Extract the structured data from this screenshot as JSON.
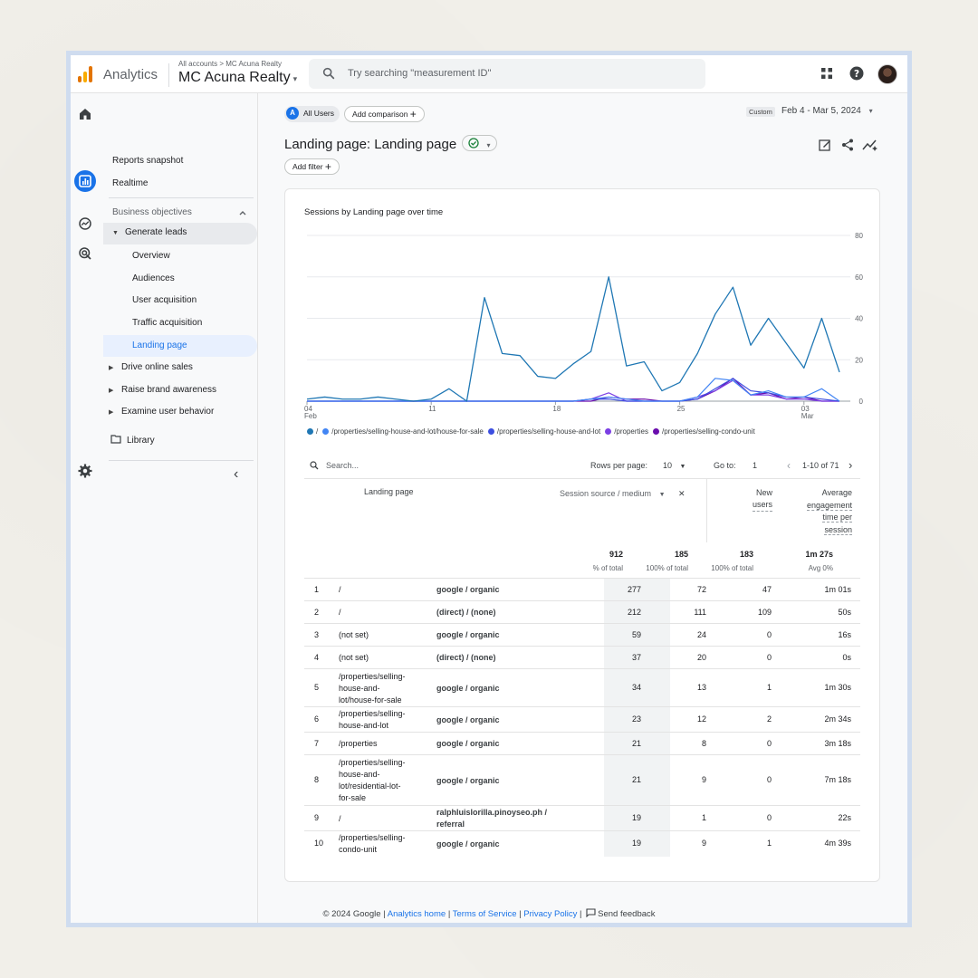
{
  "app": {
    "name": "Analytics",
    "breadcrumb": "All accounts > MC Acuna Realty",
    "account": "MC Acuna Realty",
    "caret": "▾"
  },
  "search": {
    "placeholder": "Try searching \"measurement ID\""
  },
  "icons": [
    "home-icon",
    "reports-icon",
    "explore-icon",
    "advertising-icon",
    "settings-icon",
    "apps-icon",
    "help-icon",
    "search-icon",
    "edit-icon",
    "share-icon",
    "insights-icon"
  ],
  "nav": {
    "reports_snapshot": "Reports snapshot",
    "realtime": "Realtime",
    "business_objectives": "Business objectives",
    "generate_leads": "Generate leads",
    "overview": "Overview",
    "audiences": "Audiences",
    "user_acquisition": "User acquisition",
    "traffic_acquisition": "Traffic acquisition",
    "landing_page": "Landing page",
    "drive_online_sales": "Drive online sales",
    "raise_brand_awareness": "Raise brand awareness",
    "examine_user_behavior": "Examine user behavior",
    "library": "Library",
    "collapse": "‹"
  },
  "toolbar": {
    "all_users": "All Users",
    "all_users_letter": "A",
    "add_comparison": "Add comparison",
    "plus": "+",
    "add_filter": "Add filter",
    "date_custom": "Custom",
    "date_range": "Feb 4 - Mar 5, 2024",
    "date_caret": "▾"
  },
  "page": {
    "title": "Landing page: Landing page",
    "status_caret": "▾"
  },
  "colors": {
    "series": [
      "#1f77b4",
      "#4285f4",
      "#3c4ee0",
      "#7b3fe4",
      "#6a0dad"
    ],
    "accent": "#1a73e8"
  },
  "chart_data": {
    "type": "line",
    "title": "Sessions by Landing page over time",
    "x_ticks": [
      {
        "index": 0,
        "label": "04",
        "sub": "Feb"
      },
      {
        "index": 7,
        "label": "11",
        "sub": ""
      },
      {
        "index": 14,
        "label": "18",
        "sub": ""
      },
      {
        "index": 21,
        "label": "25",
        "sub": ""
      },
      {
        "index": 28,
        "label": "03",
        "sub": "Mar"
      }
    ],
    "y_ticks": [
      0,
      20,
      40,
      60,
      80
    ],
    "ylim": [
      0,
      80
    ],
    "n_points": 31,
    "series": [
      {
        "name": "/",
        "values": [
          1,
          2,
          1,
          1,
          2,
          1,
          0,
          1,
          6,
          0,
          50,
          23,
          22,
          12,
          11,
          18,
          24,
          60,
          17,
          19,
          5,
          9,
          23,
          42,
          55,
          27,
          40,
          28,
          16,
          40,
          14
        ]
      },
      {
        "name": "/properties/selling-house-and-lot/house-for-sale",
        "values": [
          0,
          0,
          0,
          0,
          0,
          0,
          0,
          0,
          0,
          0,
          0,
          0,
          0,
          0,
          0,
          0,
          1,
          2,
          1,
          0,
          0,
          0,
          2,
          11,
          10,
          3,
          5,
          2,
          2,
          6,
          0
        ]
      },
      {
        "name": "/properties/selling-house-and-lot",
        "values": [
          0,
          0,
          0,
          0,
          0,
          0,
          0,
          0,
          0,
          0,
          0,
          0,
          0,
          0,
          0,
          0,
          1,
          1,
          0,
          0,
          0,
          0,
          1,
          6,
          11,
          5,
          4,
          2,
          2,
          1,
          0
        ]
      },
      {
        "name": "/properties",
        "values": [
          0,
          0,
          0,
          0,
          0,
          0,
          0,
          0,
          0,
          0,
          0,
          0,
          0,
          0,
          0,
          0,
          1,
          4,
          0,
          0,
          0,
          0,
          2,
          5,
          10,
          3,
          3,
          1,
          1,
          0,
          0
        ]
      },
      {
        "name": "/properties/selling-condo-unit",
        "values": [
          0,
          0,
          0,
          0,
          0,
          0,
          0,
          0,
          0,
          0,
          0,
          0,
          0,
          0,
          0,
          0,
          0,
          2,
          1,
          1,
          0,
          0,
          1,
          5,
          11,
          3,
          4,
          1,
          2,
          0,
          0
        ]
      }
    ]
  },
  "table": {
    "search_placeholder": "Search...",
    "rows_per_page_label": "Rows per page:",
    "rows_per_page": "10",
    "goto_label": "Go to:",
    "goto": "1",
    "range": "1-10 of 71",
    "col_landing": "Landing page",
    "col_source": "Session source / medium",
    "col_new_users": [
      "New",
      "users"
    ],
    "col_avg": [
      "Average",
      "engagement",
      "time per",
      "session"
    ],
    "close": "✕",
    "totals": [
      {
        "value": "912",
        "sub": "% of total"
      },
      {
        "value": "185",
        "sub": "100% of total"
      },
      {
        "value": "183",
        "sub": "100% of total"
      },
      {
        "value": "1m 27s",
        "sub": "Avg 0%"
      }
    ],
    "rows": [
      {
        "n": "1",
        "page": [
          "/"
        ],
        "source": [
          "google / organic"
        ],
        "a": "277",
        "b": "72",
        "c": "47",
        "d": "1m 01s"
      },
      {
        "n": "2",
        "page": [
          "/"
        ],
        "source": [
          "(direct) / (none)"
        ],
        "a": "212",
        "b": "111",
        "c": "109",
        "d": "50s"
      },
      {
        "n": "3",
        "page": [
          "(not set)"
        ],
        "source": [
          "google / organic"
        ],
        "a": "59",
        "b": "24",
        "c": "0",
        "d": "16s"
      },
      {
        "n": "4",
        "page": [
          "(not set)"
        ],
        "source": [
          "(direct) / (none)"
        ],
        "a": "37",
        "b": "20",
        "c": "0",
        "d": "0s"
      },
      {
        "n": "5",
        "page": [
          "/properties/selling-",
          "house-and-",
          "lot/house-for-sale"
        ],
        "source": [
          "google / organic"
        ],
        "a": "34",
        "b": "13",
        "c": "1",
        "d": "1m 30s"
      },
      {
        "n": "6",
        "page": [
          "/properties/selling-",
          "house-and-lot"
        ],
        "source": [
          "google / organic"
        ],
        "a": "23",
        "b": "12",
        "c": "2",
        "d": "2m 34s"
      },
      {
        "n": "7",
        "page": [
          "/properties"
        ],
        "source": [
          "google / organic"
        ],
        "a": "21",
        "b": "8",
        "c": "0",
        "d": "3m 18s"
      },
      {
        "n": "8",
        "page": [
          "/properties/selling-",
          "house-and-",
          "lot/residential-lot-",
          "for-sale"
        ],
        "source": [
          "google / organic"
        ],
        "a": "21",
        "b": "9",
        "c": "0",
        "d": "7m 18s"
      },
      {
        "n": "9",
        "page": [
          "/"
        ],
        "source": [
          "ralphluislorilla.pinoyseo.ph /",
          "referral"
        ],
        "a": "19",
        "b": "1",
        "c": "0",
        "d": "22s"
      },
      {
        "n": "10",
        "page": [
          "/properties/selling-",
          "condo-unit"
        ],
        "source": [
          "google / organic"
        ],
        "a": "19",
        "b": "9",
        "c": "1",
        "d": "4m 39s"
      }
    ]
  },
  "footer": {
    "copyright": "© 2024 Google |",
    "analytics_home": "Analytics home",
    "sep": "|",
    "terms": "Terms of Service",
    "privacy": "Privacy Policy",
    "feedback": "Send feedback"
  }
}
